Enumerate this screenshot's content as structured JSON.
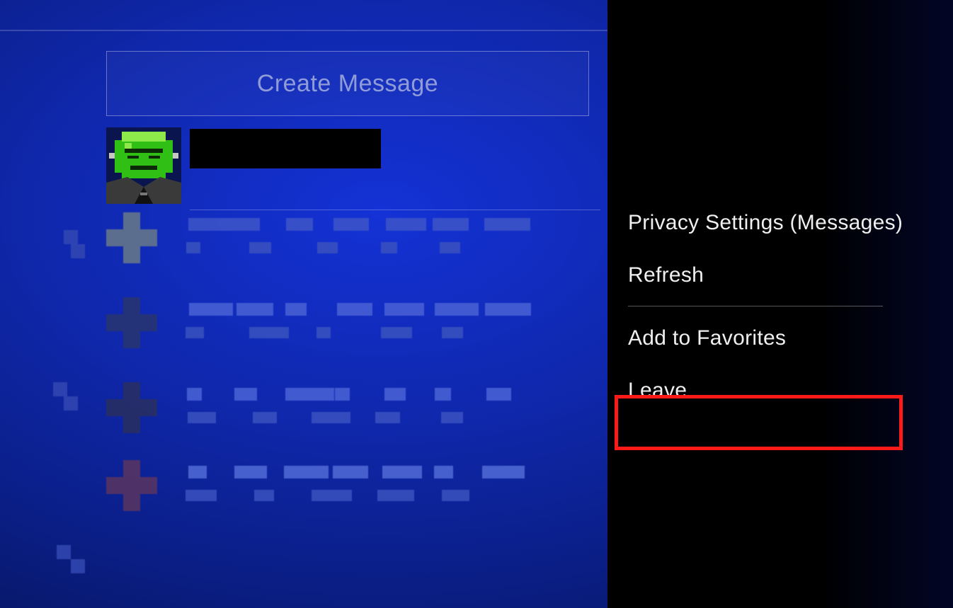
{
  "header": {
    "create_message_label": "Create Message"
  },
  "menu": {
    "privacy_label": "Privacy Settings (Messages)",
    "refresh_label": "Refresh",
    "add_favorites_label": "Add to Favorites",
    "leave_label": "Leave"
  }
}
